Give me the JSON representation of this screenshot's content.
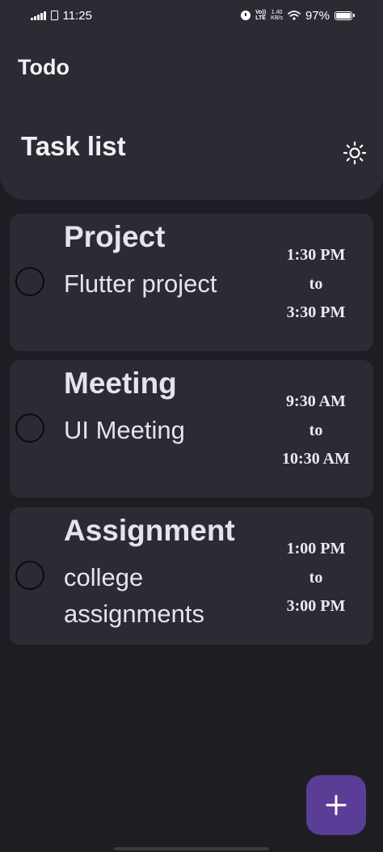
{
  "status_bar": {
    "time": "11:25",
    "volte_top": "Vo))",
    "volte_bottom": "LTE",
    "speed_value": "1.40",
    "speed_unit": "KB/s",
    "battery": "97%"
  },
  "header": {
    "app_title": "Todo",
    "page_title": "Task list",
    "theme_icon": "sun-icon"
  },
  "tasks": [
    {
      "title": "Project",
      "description": "Flutter project",
      "start": "1:30 PM",
      "separator": "to",
      "end": "3:30 PM",
      "done": false
    },
    {
      "title": "Meeting",
      "description": "UI Meeting",
      "start": "9:30 AM",
      "separator": "to",
      "end": "10:30 AM",
      "done": false
    },
    {
      "title": "Assignment",
      "description": "college assignments",
      "start": "1:00 PM",
      "separator": "to",
      "end": "3:00 PM",
      "done": false
    }
  ],
  "fab": {
    "icon": "plus-icon"
  },
  "colors": {
    "background": "#1e1d23",
    "surface": "#2c2b33",
    "accent": "#5a3d96",
    "text": "#e6e3ec"
  }
}
